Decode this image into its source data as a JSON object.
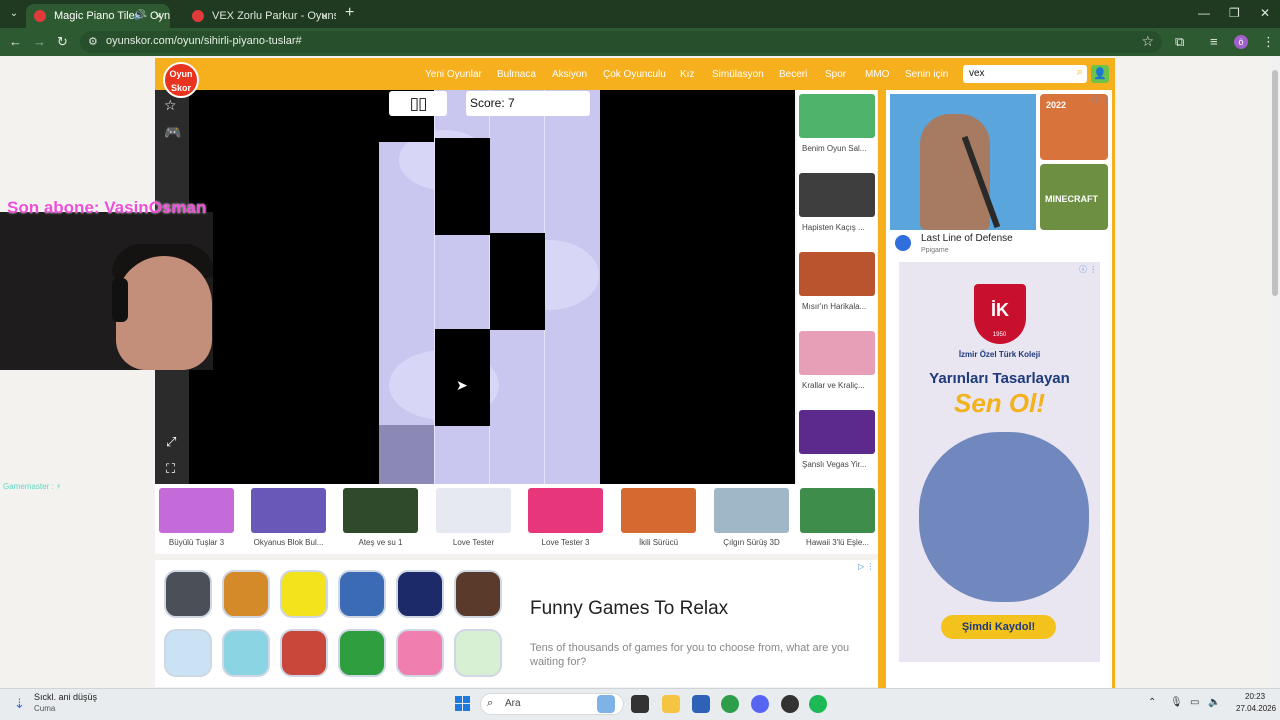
{
  "browser": {
    "tabs": [
      {
        "title": "Magic Piano Tiles - Oyna M",
        "active": true
      },
      {
        "title": "VEX Zorlu Parkur - Oyunskor.co",
        "active": false
      }
    ],
    "url": "oyunskor.com/oyun/sihirli-piyano-tuslar#",
    "profile_initial": "ö"
  },
  "site": {
    "logo_text": "Oyun Skor",
    "nav": [
      "Yeni Oyunlar",
      "Bulmaca",
      "Aksiyon",
      "Çok Oyunculu",
      "Kız",
      "Simülasyon",
      "Beceri",
      "Spor",
      "MMO",
      "Senin için"
    ],
    "search_value": "vex"
  },
  "game": {
    "score_label": "Score: 7",
    "pause_symbol": "▯▯"
  },
  "stream": {
    "subscriber_banner": "Son abone: VasinOsman",
    "gamemaster_label": "Gamemaster :"
  },
  "side_games": [
    "Benim Oyun Sal...",
    "Hapisten Kaçış ...",
    "Mısır'ın Harikala...",
    "Krallar ve Kraliç...",
    "Şanslı Vegas Yir..."
  ],
  "bottom_games": [
    "Büyülü Tuşlar 3",
    "Okyanus Blok Bul...",
    "Ateş ve su 1",
    "Love Tester",
    "Love Tester 3",
    "İkili Sürücü",
    "Çılgın Sürüş 3D",
    "Hawaii 3'lü Eşle..."
  ],
  "ad_bottom": {
    "title": "Funny Games To Relax",
    "description": "Tens of thousands of games for you to choose from, what are you waiting for?"
  },
  "ad_top": {
    "game_name": "Last Line of Defense",
    "publisher": "Ppigame",
    "small_labels": [
      "2022",
      "MINECRAFT"
    ]
  },
  "ad_school": {
    "logo": "İK",
    "year": "1950",
    "school_name": "İzmir Özel Türk Koleji",
    "headline": "Yarınları Tasarlayan",
    "headline_emphasis": "Sen Ol!",
    "cta": "Şimdi Kaydol!"
  },
  "taskbar": {
    "weather_title": "Sıckl. ani düşüş",
    "weather_sub": "Cuma",
    "search_placeholder": "Ara",
    "time": "20:23",
    "date": "27.04.2026"
  },
  "colors": {
    "site_header": "#f6b01e",
    "browser_frame": "#2e5a31",
    "piano_board": "#c9c6f0",
    "banner_text": "#ee4fd8"
  }
}
